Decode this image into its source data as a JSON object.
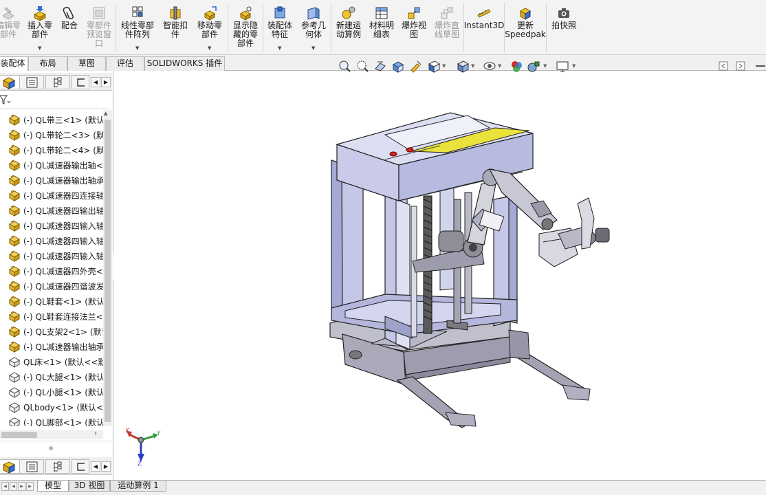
{
  "ribbon": {
    "edit_component": "编辑零\n部件",
    "insert_components": "插入零\n部件",
    "mate": "配合",
    "component_preview": "零部件\n预览窗\n口",
    "linear_pattern": "线性零部\n件阵列",
    "smart_fasteners": "智能扣\n件",
    "move_component": "移动零\n部件",
    "show_hidden": "显示隐\n藏的零\n部件",
    "assembly_features": "装配体\n特征",
    "reference_geometry": "参考几\n何体",
    "new_motion_study": "新建运\n动算例",
    "bom": "材料明\n细表",
    "exploded_view": "爆炸视\n图",
    "explode_line": "爆炸直\n线草图",
    "instant3d": "Instant3D",
    "update_speedpak": "更新\nSpeedpak",
    "snapshot": "拍快照"
  },
  "tabs": [
    "装配体",
    "布局",
    "草图",
    "评估",
    "SOLIDWORKS 插件"
  ],
  "tree": {
    "items": [
      {
        "label": "(-) QL带三<1> (默认",
        "icon": "part-yellow-icon"
      },
      {
        "label": "(-) QL带轮二<3> (默",
        "icon": "part-yellow-icon"
      },
      {
        "label": "(-) QL带轮二<4> (默",
        "icon": "part-yellow-icon"
      },
      {
        "label": "(-) QL减速器输出轴<",
        "icon": "part-yellow-icon"
      },
      {
        "label": "(-) QL减速器输出轴承",
        "icon": "part-yellow-icon"
      },
      {
        "label": "(-) QL减速器四连接轴",
        "icon": "part-yellow-icon"
      },
      {
        "label": "(-) QL减速器四输出轴",
        "icon": "part-yellow-icon"
      },
      {
        "label": "(-) QL减速器四输入轴",
        "icon": "part-yellow-icon"
      },
      {
        "label": "(-) QL减速器四输入轴",
        "icon": "part-yellow-icon"
      },
      {
        "label": "(-) QL减速器四输入轴",
        "icon": "part-yellow-icon"
      },
      {
        "label": "(-) QL减速器四外壳<",
        "icon": "part-yellow-icon"
      },
      {
        "label": "(-) QL减速器四谐波发",
        "icon": "part-yellow-icon"
      },
      {
        "label": "(-) QL鞋套<1> (默认",
        "icon": "part-yellow-icon"
      },
      {
        "label": "(-) QL鞋套连接法兰<",
        "icon": "part-yellow-icon"
      },
      {
        "label": "(-) QL支架2<1> (默认",
        "icon": "part-yellow-icon"
      },
      {
        "label": "(-) QL减速器输出轴承",
        "icon": "part-yellow-icon"
      },
      {
        "label": "QL床<1> (默认<<默",
        "icon": "subassembly-icon"
      },
      {
        "label": "(-) QL大腿<1> (默认",
        "icon": "subassembly-icon"
      },
      {
        "label": "(-) QL小腿<1> (默认",
        "icon": "subassembly-icon"
      },
      {
        "label": "QLbody<1> (默认<",
        "icon": "subassembly-icon"
      },
      {
        "label": "(-) QL脚部<1> (默认",
        "icon": "subassembly-icon"
      }
    ]
  },
  "bottom_tabs": [
    "模型",
    "3D 视图",
    "运动算例 1"
  ],
  "triad": {
    "x": "X",
    "y": "Y",
    "z": "Z"
  },
  "colors": {
    "frame": "#b5b8d8",
    "frame_dark": "#7d80a8",
    "base": "#a9a9b9",
    "panel_yellow": "#e8e23a",
    "button_red": "#e0201c",
    "bearing": "#6f6f75",
    "triad_x": "#c0392b",
    "triad_y": "#2e9e3a",
    "triad_z": "#2b3cc4"
  }
}
